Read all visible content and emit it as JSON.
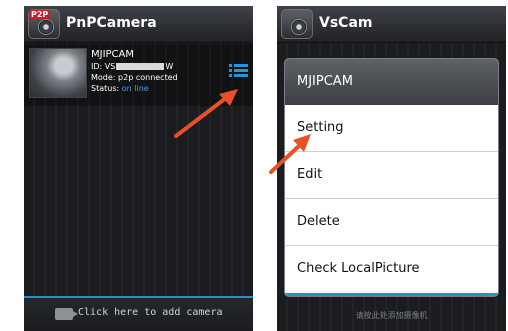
{
  "left_screen": {
    "app_title": "PnPCamera",
    "icon_badge": "P2P",
    "camera": {
      "name": "MJIPCAM",
      "id_prefix": "ID: VS",
      "id_suffix": "W",
      "mode": "Mode: p2p connected",
      "status_label": "Status:",
      "status_value": "on line"
    },
    "add_camera_label": "Click here to add camera"
  },
  "right_screen": {
    "app_title": "VsCam",
    "dialog": {
      "title": "MJIPCAM",
      "items": [
        "Setting",
        "Edit",
        "Delete",
        "Check LocalPicture"
      ]
    },
    "bottom_hint": "请按此处添加摄像机"
  },
  "colors": {
    "accent": "#2e8cc9",
    "arrow": "#e8502a",
    "online": "#3fa0ff"
  }
}
